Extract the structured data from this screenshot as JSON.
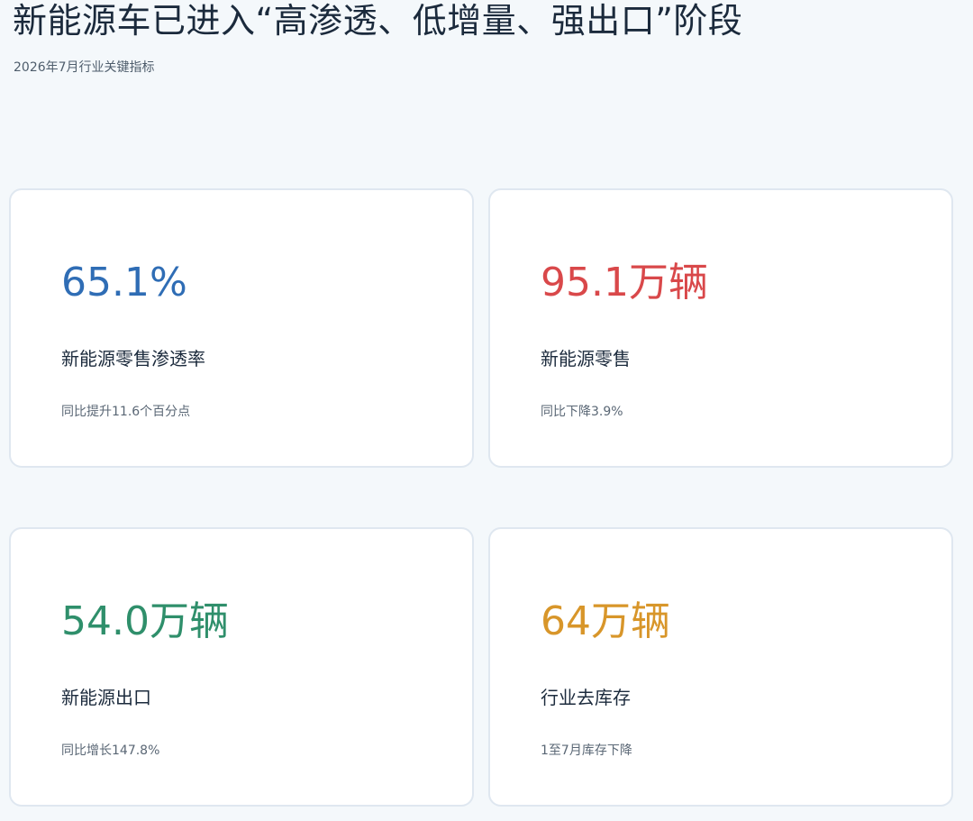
{
  "header": {
    "title": "新能源车已进入“高渗透、低增量、强出口”阶段",
    "subtitle": "2026年7月行业关键指标"
  },
  "cards": [
    {
      "value": "65.1%",
      "label": "新能源零售渗透率",
      "note": "同比提升11.6个百分点",
      "color": "#2f6db5"
    },
    {
      "value": "95.1万辆",
      "label": "新能源零售",
      "note": "同比下降3.9%",
      "color": "#d9484a"
    },
    {
      "value": "54.0万辆",
      "label": "新能源出口",
      "note": "同比增长147.8%",
      "color": "#2f8f6b"
    },
    {
      "value": "64万辆",
      "label": "行业去库存",
      "note": "1至7月库存下降",
      "color": "#d8962a"
    }
  ]
}
